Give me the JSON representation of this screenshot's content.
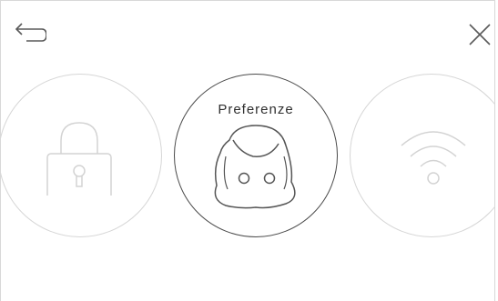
{
  "header": {
    "back_icon": "back-arrow-icon",
    "close_icon": "close-icon"
  },
  "carousel": {
    "items": [
      {
        "id": "security",
        "label": "",
        "icon": "lock-icon",
        "state": "inactive"
      },
      {
        "id": "preferences",
        "label": "Preferenze",
        "icon": "face-icon",
        "state": "active"
      },
      {
        "id": "network",
        "label": "",
        "icon": "wifi-icon",
        "state": "inactive"
      }
    ]
  },
  "colors": {
    "active_stroke": "#4a4a4a",
    "inactive_stroke": "#d6d6d6",
    "icon_stroke": "#555555",
    "background": "#ffffff"
  }
}
